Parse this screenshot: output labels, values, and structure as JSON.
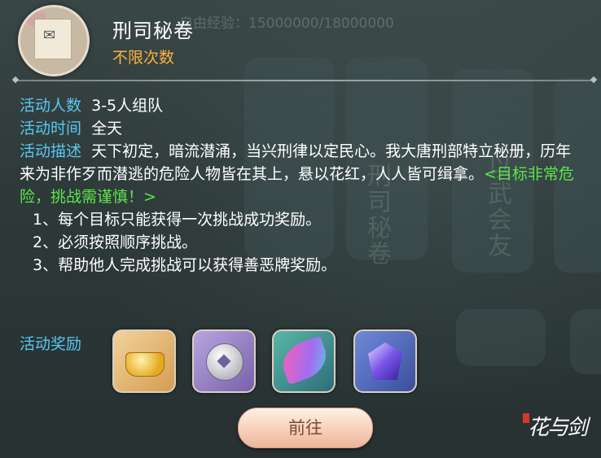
{
  "header": {
    "title": "刑司秘卷",
    "subtitle": "不限次数",
    "background_exp_text": "自由经验：15000000/18000000"
  },
  "background_ghost_text": [
    "刑司秘卷",
    "以武会友"
  ],
  "info": {
    "people_label": "活动人数",
    "people_value": "3-5人组队",
    "time_label": "活动时间",
    "time_value": "全天",
    "desc_label": "活动描述",
    "desc_text": "天下初定，暗流潜涌，当兴刑律以定民心。我大唐刑部特立秘册，历年来为非作歹而潜逃的危险人物皆在其上，悬以花红，人人皆可缉拿。",
    "desc_warning": "<目标非常危险，挑战需谨慎！>"
  },
  "rules": [
    "1、每个目标只能获得一次挑战成功奖励。",
    "2、必须按照顺序挑战。",
    "3、帮助他人完成挑战可以获得善恶牌奖励。"
  ],
  "rewards": {
    "label": "活动奖励",
    "items": [
      {
        "icon": "gold-ingot-chain-icon"
      },
      {
        "icon": "silver-coin-icon"
      },
      {
        "icon": "pink-feather-icon"
      },
      {
        "icon": "purple-crystal-icon"
      }
    ]
  },
  "button": {
    "label": "前往"
  },
  "logo": {
    "text": "花与剑"
  },
  "colors": {
    "label_blue": "#56c8f0",
    "subtitle_orange": "#ffb23a",
    "warning_green": "#5ce64a",
    "button_text": "#7b4c36"
  }
}
